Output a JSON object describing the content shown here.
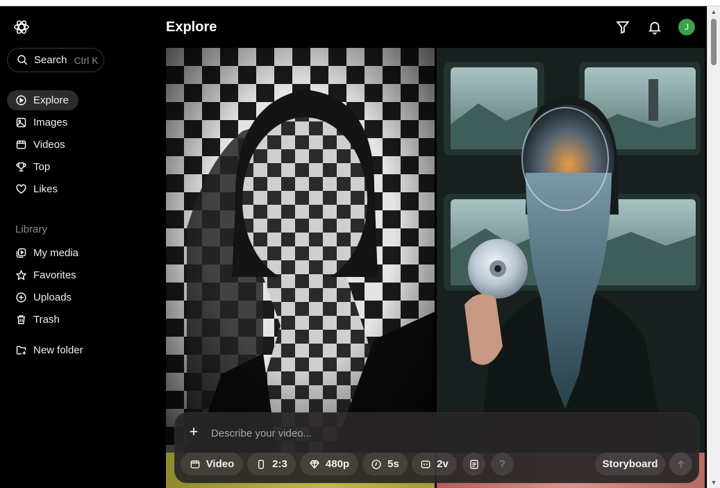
{
  "app": {
    "logo_name": "openai-logo-icon"
  },
  "search": {
    "label": "Search",
    "shortcut": "Ctrl K"
  },
  "nav": {
    "items": [
      {
        "label": "Explore",
        "icon": "explore-icon",
        "active": true
      },
      {
        "label": "Images",
        "icon": "image-icon"
      },
      {
        "label": "Videos",
        "icon": "video-icon"
      },
      {
        "label": "Top",
        "icon": "trophy-icon"
      },
      {
        "label": "Likes",
        "icon": "heart-icon"
      }
    ]
  },
  "library": {
    "title": "Library",
    "items": [
      {
        "label": "My media",
        "icon": "media-icon"
      },
      {
        "label": "Favorites",
        "icon": "star-icon"
      },
      {
        "label": "Uploads",
        "icon": "upload-icon"
      },
      {
        "label": "Trash",
        "icon": "trash-icon"
      }
    ],
    "new_folder": "New folder"
  },
  "header": {
    "title": "Explore",
    "avatar_initial": "J",
    "avatar_color": "#3aa34a"
  },
  "composer": {
    "placeholder": "Describe your video...",
    "chips": {
      "type": "Video",
      "aspect": "2:3",
      "resolution": "480p",
      "duration": "5s",
      "variations": "2v",
      "storyboard": "Storyboard",
      "help": "?"
    }
  },
  "gallery": {
    "tiles": [
      {
        "name": "checkerboard-portrait",
        "kind": "image"
      },
      {
        "name": "glass-head-cd-portrait",
        "kind": "image"
      },
      {
        "name": "yellow-tile",
        "kind": "image"
      },
      {
        "name": "pink-tile",
        "kind": "image"
      }
    ]
  }
}
